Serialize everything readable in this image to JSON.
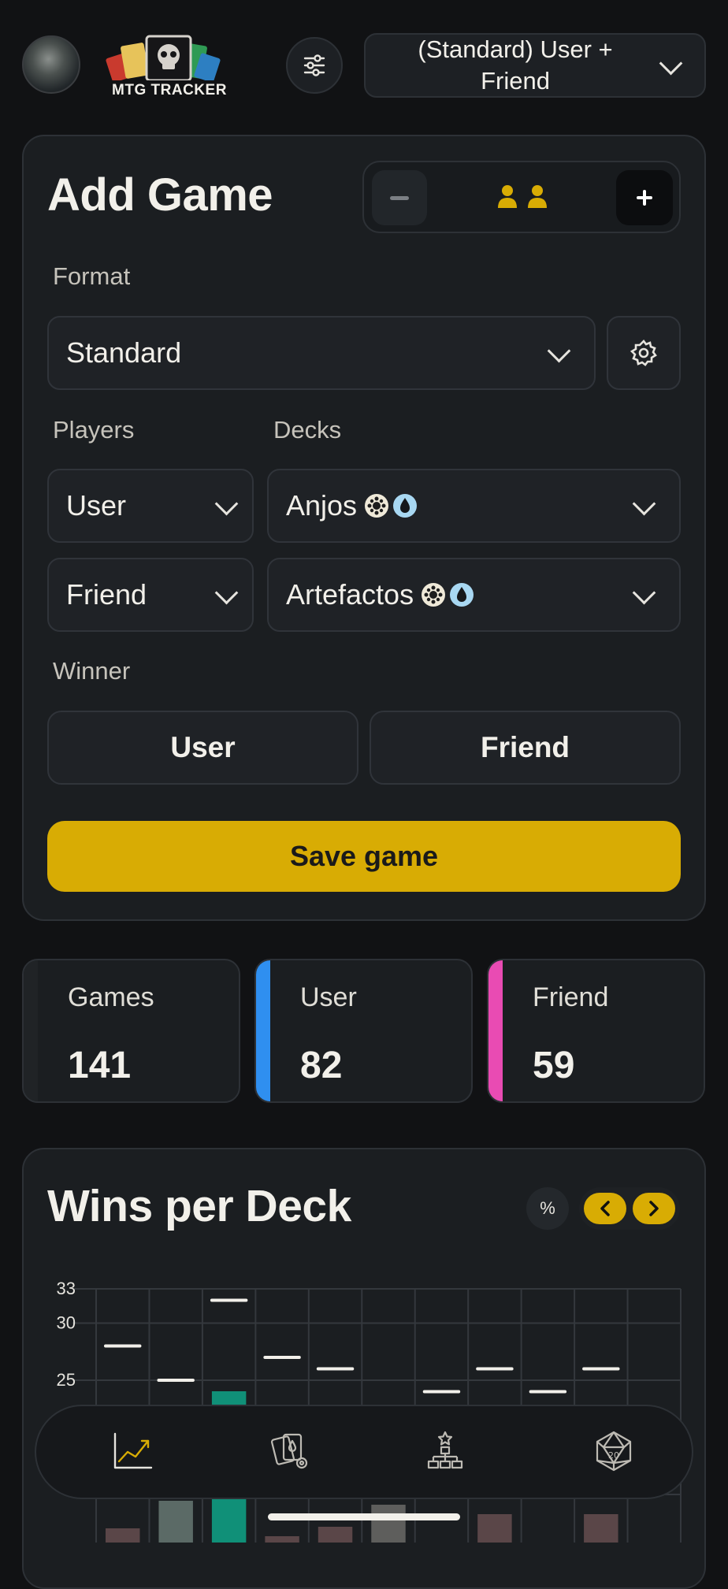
{
  "header": {
    "logo_text": "MTG TRACKER",
    "selector_label": "(Standard) User + Friend"
  },
  "add_game": {
    "title": "Add Game",
    "format_label": "Format",
    "format_value": "Standard",
    "players_label": "Players",
    "decks_label": "Decks",
    "rows": [
      {
        "player": "User",
        "deck": "Anjos",
        "colors": [
          "white",
          "blue"
        ]
      },
      {
        "player": "Friend",
        "deck": "Artefactos",
        "colors": [
          "white",
          "blue"
        ]
      }
    ],
    "winner_label": "Winner",
    "winner_options": [
      "User",
      "Friend"
    ],
    "save_label": "Save game",
    "player_count": 2
  },
  "stats": [
    {
      "label": "Games",
      "value": "141",
      "color": "#202326"
    },
    {
      "label": "User",
      "value": "82",
      "color": "#2f8ff0"
    },
    {
      "label": "Friend",
      "value": "59",
      "color": "#e94bb3"
    }
  ],
  "wins_chart": {
    "title": "Wins per Deck",
    "percent_toggle": "%",
    "y_ticks": [
      "33",
      "30",
      "25"
    ]
  },
  "chart_data": {
    "type": "bar",
    "title": "Wins per Deck",
    "ylim_visible": [
      null,
      33
    ],
    "y_ticks": [
      33,
      30,
      25
    ],
    "markers": [
      28,
      25,
      32,
      27,
      26,
      null,
      24,
      26,
      24,
      26,
      null
    ],
    "bar_colors": [
      "#5a4648",
      "#5b6a66",
      "#109078",
      "#5a4648",
      "#5a4648",
      "#5e5e5c",
      null,
      "#5a4648",
      null,
      "#5a4648",
      null
    ]
  },
  "bottom_nav": {
    "items": [
      "chart-icon",
      "cards-settings-icon",
      "tournament-icon",
      "d20-icon"
    ]
  },
  "colors": {
    "accent": "#d8ac04",
    "user": "#2f8ff0",
    "friend": "#e94bb3"
  }
}
